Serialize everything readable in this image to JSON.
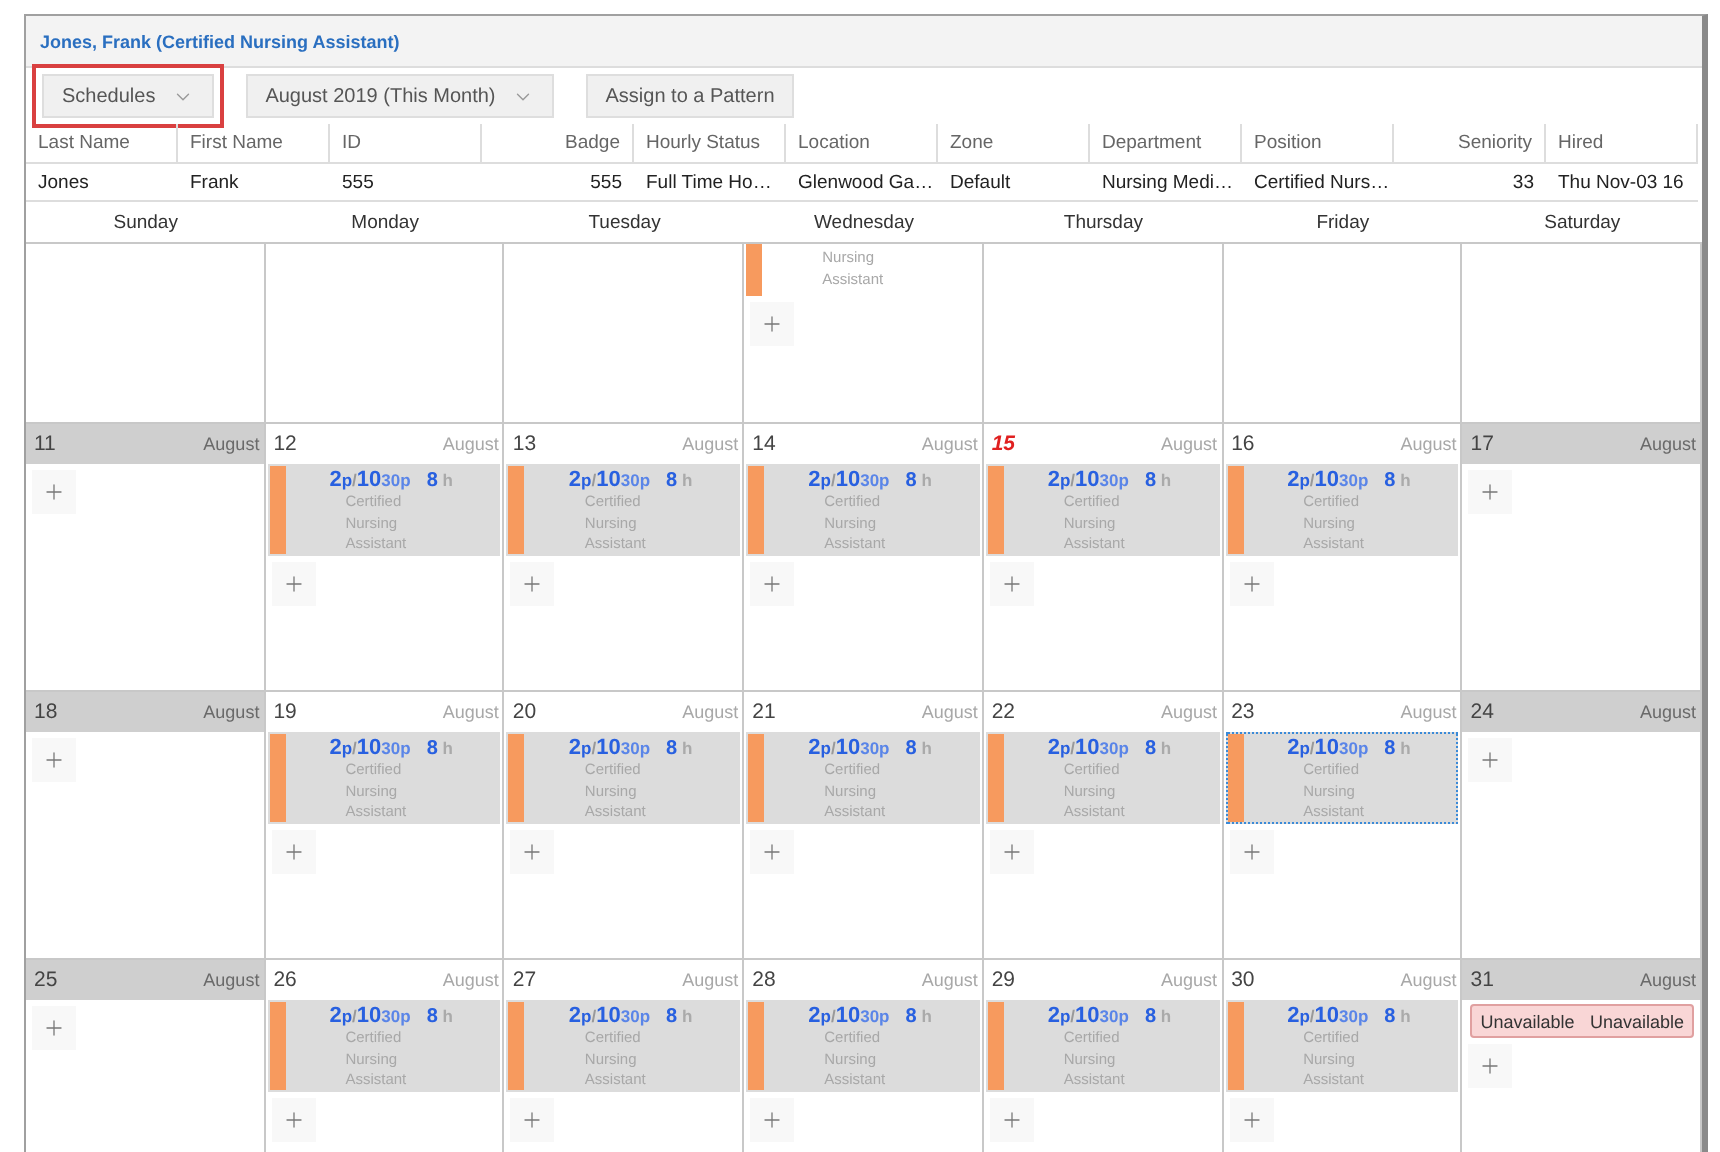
{
  "header": {
    "title": "Jones, Frank (Certified Nursing Assistant)"
  },
  "toolbar": {
    "buttons": [
      {
        "label": "Schedules",
        "dropdown": true,
        "highlighted": true
      },
      {
        "label": "August 2019 (This Month)",
        "dropdown": true,
        "highlighted": false
      },
      {
        "label": "Assign to a Pattern",
        "dropdown": false,
        "highlighted": false
      }
    ]
  },
  "employee_table": {
    "columns": [
      {
        "label": "Last Name",
        "kind": "text"
      },
      {
        "label": "First Name",
        "kind": "text"
      },
      {
        "label": "ID",
        "kind": "text"
      },
      {
        "label": "Badge",
        "kind": "number"
      },
      {
        "label": "Hourly Status",
        "kind": "text"
      },
      {
        "label": "Location",
        "kind": "text"
      },
      {
        "label": "Zone",
        "kind": "text"
      },
      {
        "label": "Department",
        "kind": "text"
      },
      {
        "label": "Position",
        "kind": "text"
      },
      {
        "label": "Seniority",
        "kind": "number"
      },
      {
        "label": "Hired",
        "kind": "text"
      }
    ],
    "row": [
      "Jones",
      "Frank",
      "555",
      "555",
      "Full Time Ho…",
      "Glenwood Ga…",
      "Default",
      "Nursing Medi…",
      "Certified Nurs…",
      "33",
      "Thu Nov-03 16"
    ]
  },
  "calendar": {
    "weekdays": [
      "Sunday",
      "Monday",
      "Tuesday",
      "Wednesday",
      "Thursday",
      "Friday",
      "Saturday"
    ],
    "weeks": [
      {
        "days": [
          {
            "add_button": false
          },
          {
            "add_button": false
          },
          {
            "add_button": false
          },
          {
            "add_button": true,
            "items": [
              {
                "kind": "shift_tail",
                "role": "Nursing Assistant"
              }
            ]
          },
          {
            "add_button": false
          },
          {
            "add_button": false
          },
          {
            "add_button": false
          }
        ]
      },
      {
        "days": [
          {
            "number": "11",
            "month": "August",
            "weekend": true,
            "today": false,
            "add_button": true
          },
          {
            "number": "12",
            "month": "August",
            "weekend": false,
            "today": false,
            "add_button": true,
            "items": [
              {
                "kind": "shift",
                "selected": false,
                "start": "2",
                "start_suffix": "p",
                "separator": "/",
                "end": "10",
                "end_suffix": "30p",
                "hours": "8",
                "hours_unit": "h",
                "role": "Certified Nursing Assistant"
              }
            ]
          },
          {
            "number": "13",
            "month": "August",
            "weekend": false,
            "today": false,
            "add_button": true,
            "items": [
              {
                "kind": "shift",
                "selected": false,
                "start": "2",
                "start_suffix": "p",
                "separator": "/",
                "end": "10",
                "end_suffix": "30p",
                "hours": "8",
                "hours_unit": "h",
                "role": "Certified Nursing Assistant"
              }
            ]
          },
          {
            "number": "14",
            "month": "August",
            "weekend": false,
            "today": false,
            "add_button": true,
            "items": [
              {
                "kind": "shift",
                "selected": false,
                "start": "2",
                "start_suffix": "p",
                "separator": "/",
                "end": "10",
                "end_suffix": "30p",
                "hours": "8",
                "hours_unit": "h",
                "role": "Certified Nursing Assistant"
              }
            ]
          },
          {
            "number": "15",
            "month": "August",
            "weekend": false,
            "today": true,
            "add_button": true,
            "items": [
              {
                "kind": "shift",
                "selected": false,
                "start": "2",
                "start_suffix": "p",
                "separator": "/",
                "end": "10",
                "end_suffix": "30p",
                "hours": "8",
                "hours_unit": "h",
                "role": "Certified Nursing Assistant"
              }
            ]
          },
          {
            "number": "16",
            "month": "August",
            "weekend": false,
            "today": false,
            "add_button": true,
            "items": [
              {
                "kind": "shift",
                "selected": false,
                "start": "2",
                "start_suffix": "p",
                "separator": "/",
                "end": "10",
                "end_suffix": "30p",
                "hours": "8",
                "hours_unit": "h",
                "role": "Certified Nursing Assistant"
              }
            ]
          },
          {
            "number": "17",
            "month": "August",
            "weekend": true,
            "today": false,
            "add_button": true
          }
        ]
      },
      {
        "days": [
          {
            "number": "18",
            "month": "August",
            "weekend": true,
            "today": false,
            "add_button": true
          },
          {
            "number": "19",
            "month": "August",
            "weekend": false,
            "today": false,
            "add_button": true,
            "items": [
              {
                "kind": "shift",
                "selected": false,
                "start": "2",
                "start_suffix": "p",
                "separator": "/",
                "end": "10",
                "end_suffix": "30p",
                "hours": "8",
                "hours_unit": "h",
                "role": "Certified Nursing Assistant"
              }
            ]
          },
          {
            "number": "20",
            "month": "August",
            "weekend": false,
            "today": false,
            "add_button": true,
            "items": [
              {
                "kind": "shift",
                "selected": false,
                "start": "2",
                "start_suffix": "p",
                "separator": "/",
                "end": "10",
                "end_suffix": "30p",
                "hours": "8",
                "hours_unit": "h",
                "role": "Certified Nursing Assistant"
              }
            ]
          },
          {
            "number": "21",
            "month": "August",
            "weekend": false,
            "today": false,
            "add_button": true,
            "items": [
              {
                "kind": "shift",
                "selected": false,
                "start": "2",
                "start_suffix": "p",
                "separator": "/",
                "end": "10",
                "end_suffix": "30p",
                "hours": "8",
                "hours_unit": "h",
                "role": "Certified Nursing Assistant"
              }
            ]
          },
          {
            "number": "22",
            "month": "August",
            "weekend": false,
            "today": false,
            "add_button": true,
            "items": [
              {
                "kind": "shift",
                "selected": false,
                "start": "2",
                "start_suffix": "p",
                "separator": "/",
                "end": "10",
                "end_suffix": "30p",
                "hours": "8",
                "hours_unit": "h",
                "role": "Certified Nursing Assistant"
              }
            ]
          },
          {
            "number": "23",
            "month": "August",
            "weekend": false,
            "today": false,
            "add_button": true,
            "items": [
              {
                "kind": "shift",
                "selected": true,
                "start": "2",
                "start_suffix": "p",
                "separator": "/",
                "end": "10",
                "end_suffix": "30p",
                "hours": "8",
                "hours_unit": "h",
                "role": "Certified Nursing Assistant"
              }
            ]
          },
          {
            "number": "24",
            "month": "August",
            "weekend": true,
            "today": false,
            "add_button": true
          }
        ]
      },
      {
        "days": [
          {
            "number": "25",
            "month": "August",
            "weekend": true,
            "today": false,
            "add_button": true
          },
          {
            "number": "26",
            "month": "August",
            "weekend": false,
            "today": false,
            "add_button": true,
            "items": [
              {
                "kind": "shift",
                "selected": false,
                "start": "2",
                "start_suffix": "p",
                "separator": "/",
                "end": "10",
                "end_suffix": "30p",
                "hours": "8",
                "hours_unit": "h",
                "role": "Certified Nursing Assistant"
              }
            ]
          },
          {
            "number": "27",
            "month": "August",
            "weekend": false,
            "today": false,
            "add_button": true,
            "items": [
              {
                "kind": "shift",
                "selected": false,
                "start": "2",
                "start_suffix": "p",
                "separator": "/",
                "end": "10",
                "end_suffix": "30p",
                "hours": "8",
                "hours_unit": "h",
                "role": "Certified Nursing Assistant"
              }
            ]
          },
          {
            "number": "28",
            "month": "August",
            "weekend": false,
            "today": false,
            "add_button": true,
            "items": [
              {
                "kind": "shift",
                "selected": false,
                "start": "2",
                "start_suffix": "p",
                "separator": "/",
                "end": "10",
                "end_suffix": "30p",
                "hours": "8",
                "hours_unit": "h",
                "role": "Certified Nursing Assistant"
              }
            ]
          },
          {
            "number": "29",
            "month": "August",
            "weekend": false,
            "today": false,
            "add_button": true,
            "items": [
              {
                "kind": "shift",
                "selected": false,
                "start": "2",
                "start_suffix": "p",
                "separator": "/",
                "end": "10",
                "end_suffix": "30p",
                "hours": "8",
                "hours_unit": "h",
                "role": "Certified Nursing Assistant"
              }
            ]
          },
          {
            "number": "30",
            "month": "August",
            "weekend": false,
            "today": false,
            "add_button": true,
            "items": [
              {
                "kind": "shift",
                "selected": false,
                "start": "2",
                "start_suffix": "p",
                "separator": "/",
                "end": "10",
                "end_suffix": "30p",
                "hours": "8",
                "hours_unit": "h",
                "role": "Certified Nursing Assistant"
              }
            ]
          },
          {
            "number": "31",
            "month": "August",
            "weekend": true,
            "today": false,
            "add_button": true,
            "items": [
              {
                "kind": "unavailable",
                "labels": [
                  "Unavailable",
                  "Unavailable"
                ]
              }
            ]
          }
        ]
      }
    ]
  }
}
